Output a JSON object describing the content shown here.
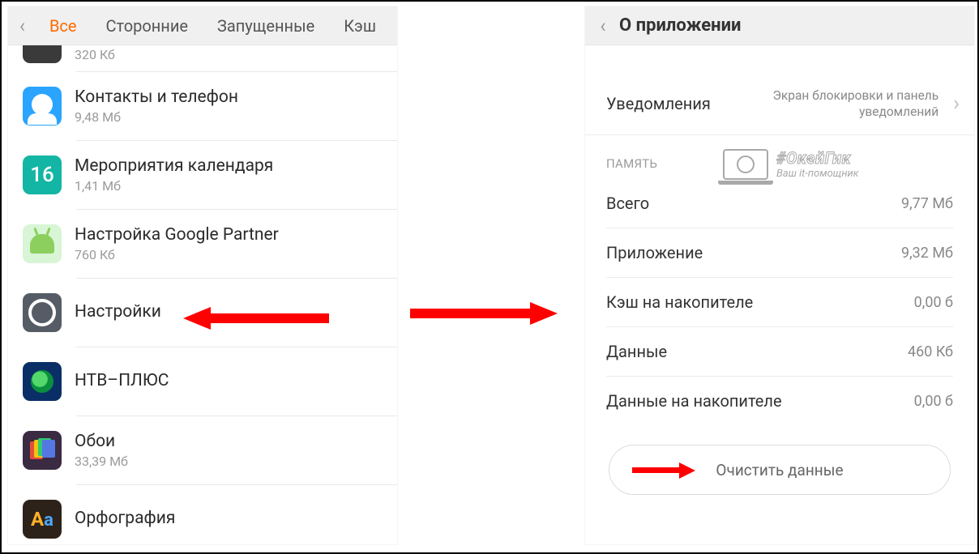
{
  "left_screen": {
    "tabs": [
      {
        "label": "Все",
        "active": true
      },
      {
        "label": "Сторонние",
        "active": false
      },
      {
        "label": "Запущенные",
        "active": false
      },
      {
        "label": "Кэш",
        "active": false
      }
    ],
    "apps": [
      {
        "id": "partial-top",
        "title": "…",
        "subtitle": "320 Кб",
        "icon": "dark-icon"
      },
      {
        "id": "contacts",
        "title": "Контакты и телефон",
        "subtitle": "9,48 Мб",
        "icon": "contact-icon"
      },
      {
        "id": "calendar",
        "title": "Мероприятия календаря",
        "subtitle": "1,41 Мб",
        "icon": "calendar-16-icon"
      },
      {
        "id": "google-partner",
        "title": "Настройка Google Partner",
        "subtitle": "760 Кб",
        "icon": "android-icon"
      },
      {
        "id": "settings",
        "title": "Настройки",
        "subtitle": "",
        "icon": "gear-icon"
      },
      {
        "id": "ntv-plus",
        "title": "НТВ–ПЛЮС",
        "subtitle": "",
        "icon": "ntv-icon"
      },
      {
        "id": "wallpapers",
        "title": "Обои",
        "subtitle": "33,39 Мб",
        "icon": "wallpapers-icon"
      },
      {
        "id": "spelling",
        "title": "Орфография",
        "subtitle": "",
        "icon": "aa-icon"
      }
    ]
  },
  "right_screen": {
    "header_title": "О приложении",
    "notifications": {
      "label": "Уведомления",
      "value": "Экран блокировки и панель уведомлений"
    },
    "memory_section_label": "ПАМЯТЬ",
    "rows": [
      {
        "label": "Всего",
        "value": "9,77 Мб"
      },
      {
        "label": "Приложение",
        "value": "9,32 Мб"
      },
      {
        "label": "Кэш на накопителе",
        "value": "0,00 б"
      },
      {
        "label": "Данные",
        "value": "460 Кб"
      },
      {
        "label": "Данные на накопителе",
        "value": "0,00 б"
      }
    ],
    "clear_button_label": "Очистить данные"
  },
  "watermark": {
    "line1": "#ОкейГик",
    "line2": "Ваш it-помощник"
  }
}
